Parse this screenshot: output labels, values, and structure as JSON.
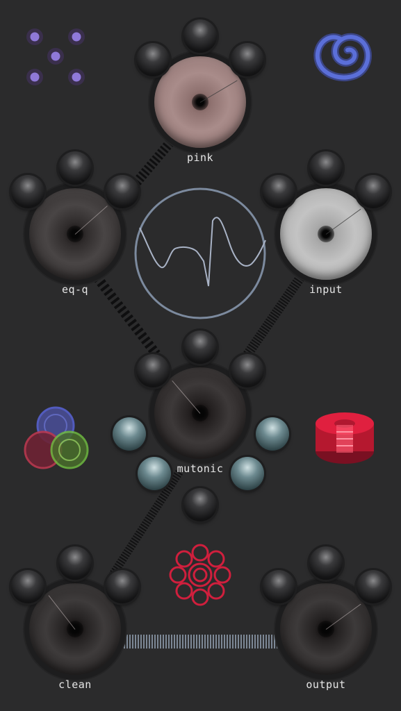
{
  "knobs": {
    "pink": {
      "label": "pink",
      "face_color": "#9a7d7b",
      "value": 0.72
    },
    "eq_q": {
      "label": "eq-q",
      "face_color": "#3a3636",
      "value": 0.68
    },
    "input": {
      "label": "input",
      "face_color": "#b4b4b4",
      "value": 0.7
    },
    "mutonic": {
      "label": "mutonic",
      "face_color": "#2e2a2a",
      "value": 0.35
    },
    "clean": {
      "label": "clean",
      "face_color": "#2f2c2c",
      "value": 0.36
    },
    "output": {
      "label": "output",
      "face_color": "#2e2b2b",
      "value": 0.7
    }
  },
  "scope": {
    "trace_color": "#a9b3c6",
    "ring_color": "#7c8a9e"
  },
  "icons": {
    "dots_color": "#8f79d8",
    "spiral_color": "#5b6fd8",
    "rgb_circles": [
      "#5964d8",
      "#d33a55",
      "#7bd345"
    ],
    "drum_color": "#e0203f",
    "flower_color": "#d01f3d"
  },
  "cables": {
    "dark": "#111111",
    "light": "#7d8896"
  }
}
